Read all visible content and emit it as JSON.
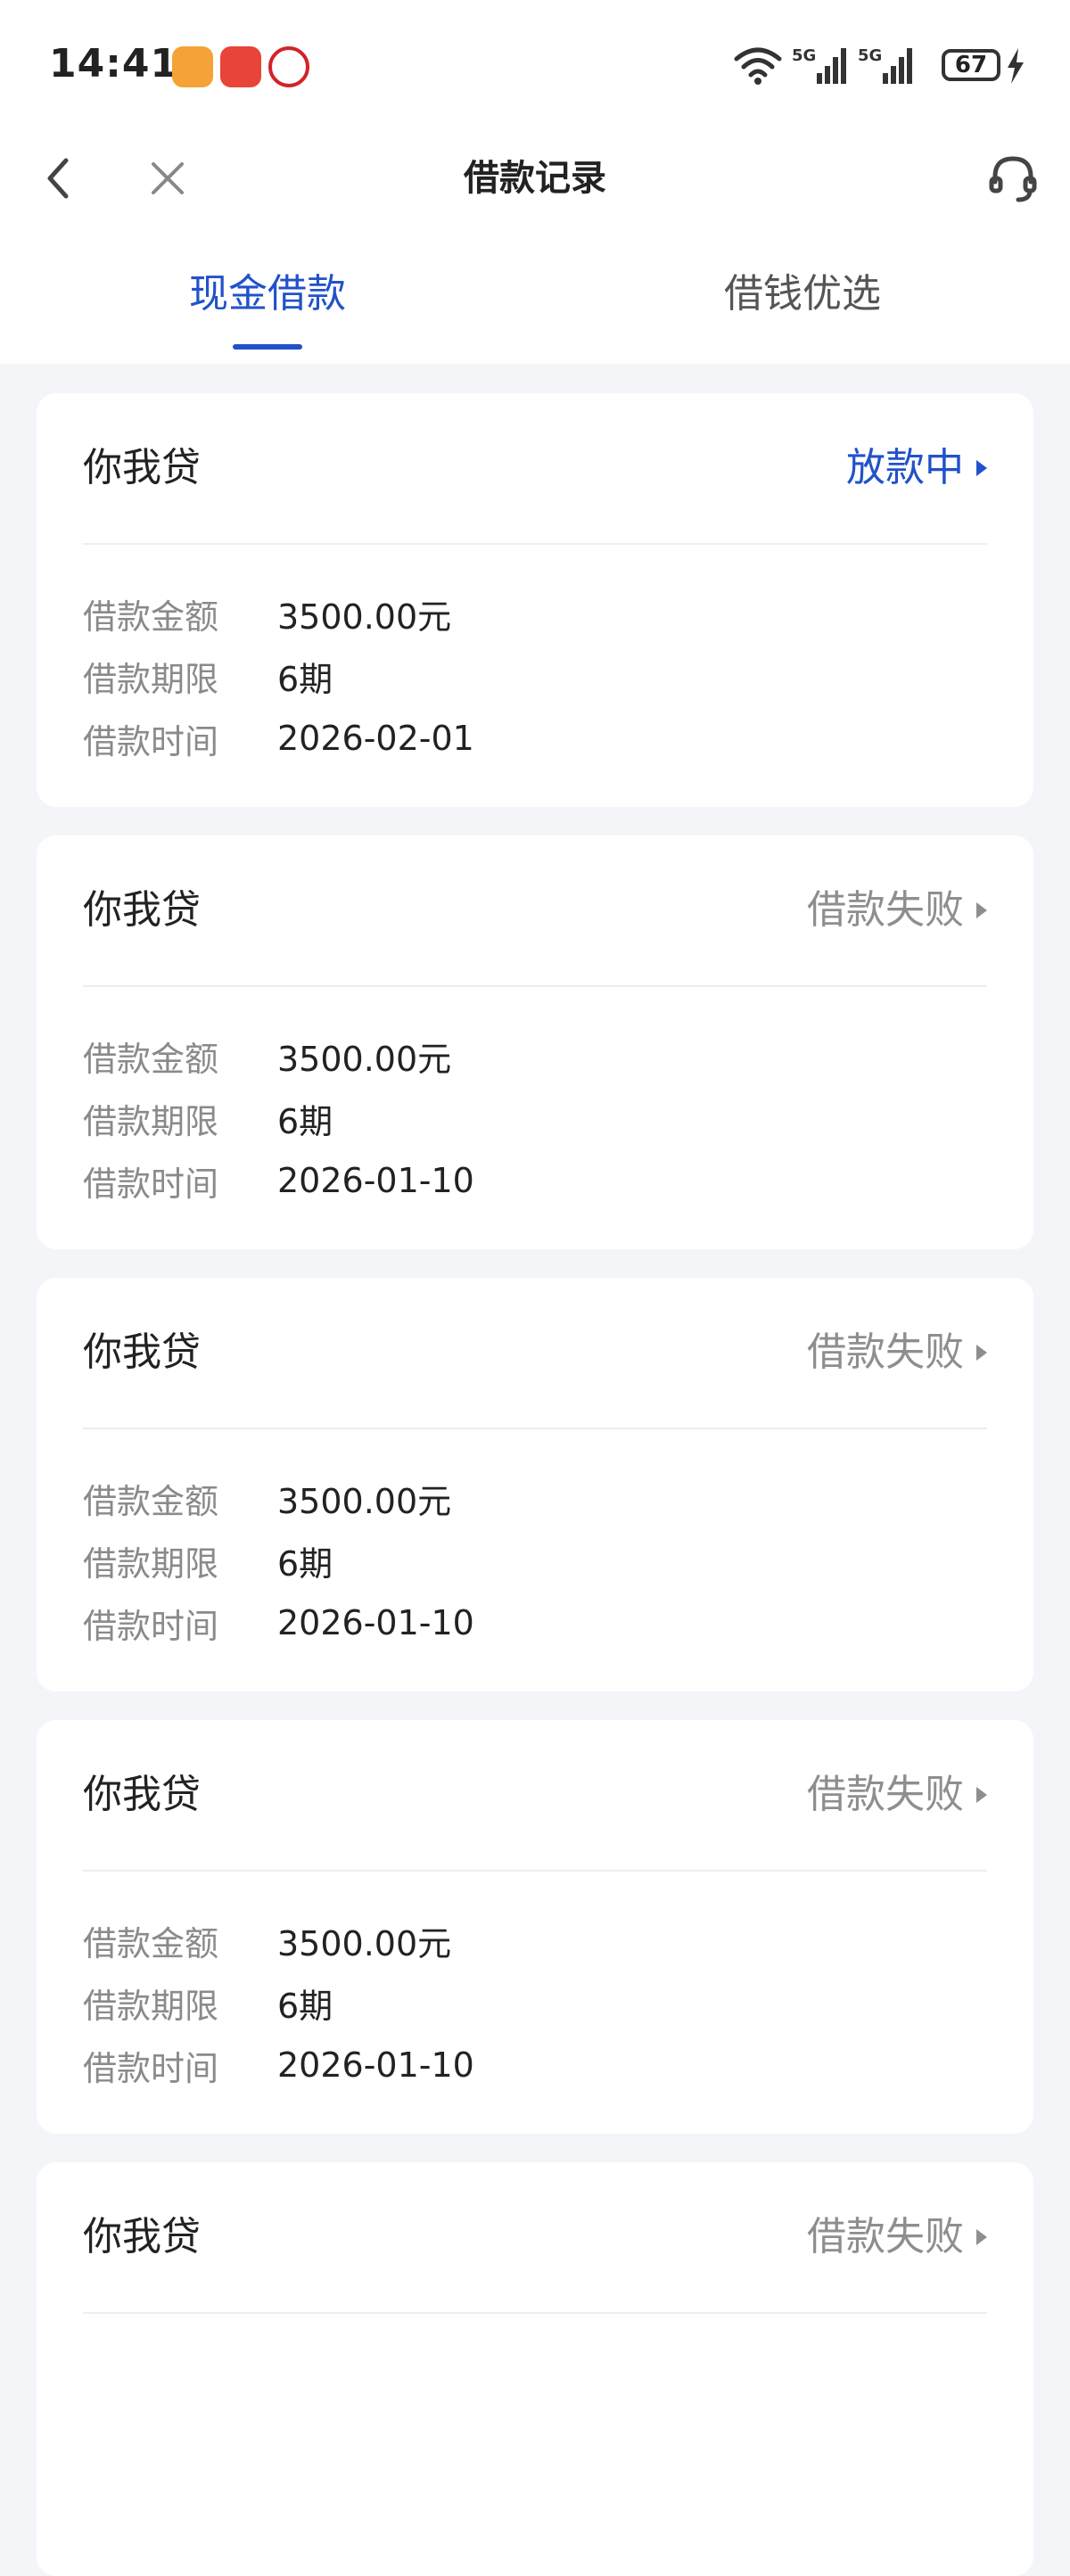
{
  "status_bar": {
    "time": "14:41",
    "app_icons": [
      "taobao-app-icon",
      "game-app-icon",
      "bank-app-icon"
    ],
    "network": [
      "wifi-icon",
      "5G",
      "5G"
    ],
    "battery": "67"
  },
  "nav": {
    "back_icon": "chevron-left-icon",
    "close_icon": "close-icon",
    "title": "借款记录",
    "service_icon": "headset-icon"
  },
  "tabs": [
    {
      "label": "现金借款",
      "active": true
    },
    {
      "label": "借钱优选",
      "active": false
    }
  ],
  "labels": {
    "amount": "借款金额",
    "term": "借款期限",
    "time": "借款时间"
  },
  "colors": {
    "accent": "#2152c9",
    "status_fail": "#8e8e8e",
    "page_bg": "#f3f5f9"
  },
  "records": [
    {
      "name": "你我贷",
      "status": "放款中",
      "status_type": "processing",
      "amount": "3500.00元",
      "term": "6期",
      "time": "2026-02-01"
    },
    {
      "name": "你我贷",
      "status": "借款失败",
      "status_type": "failed",
      "amount": "3500.00元",
      "term": "6期",
      "time": "2026-01-10"
    },
    {
      "name": "你我贷",
      "status": "借款失败",
      "status_type": "failed",
      "amount": "3500.00元",
      "term": "6期",
      "time": "2026-01-10"
    },
    {
      "name": "你我贷",
      "status": "借款失败",
      "status_type": "failed",
      "amount": "3500.00元",
      "term": "6期",
      "time": "2026-01-10"
    },
    {
      "name": "你我贷",
      "status": "借款失败",
      "status_type": "failed",
      "amount": "",
      "term": "",
      "time": ""
    }
  ]
}
